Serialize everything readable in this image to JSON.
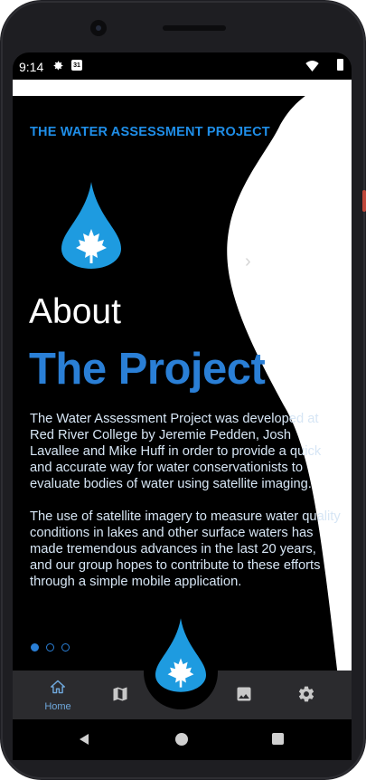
{
  "status_bar": {
    "time": "9:14",
    "calendar_day": "31",
    "icons": [
      "gear-icon",
      "calendar-icon",
      "wifi-icon",
      "battery-icon"
    ]
  },
  "content": {
    "brand_title": "THE WATER ASSESSMENT PROJECT",
    "heading_light": "About",
    "heading_bold": "The Project",
    "paragraph_1": "The Water Assessment Project was developed at Red River College by Jeremie Pedden, Josh Lavallee and Mike Huff in order to provide a quick and accurate way for water conservationists to evaluate bodies of water using satellite imaging.",
    "paragraph_2": "The use of satellite imagery to measure water quality conditions in lakes and other surface waters has made tremendous advances in the last 20 years, and our group hopes to contribute to these efforts through a simple mobile application.",
    "next_icon": "chevron-right-icon",
    "page_count": 3,
    "active_page": 1
  },
  "bottom_nav": {
    "home_label": "Home",
    "items": [
      "home-icon",
      "map-icon",
      "water-drop-logo",
      "image-icon",
      "settings-icon"
    ]
  },
  "colors": {
    "accent_blue": "#2a7fd6",
    "title_blue": "#1f8ee8",
    "drop_blue": "#1e9be0",
    "screen_bg": "#000000",
    "wave_panel": "#ffffff",
    "nav_bg": "#2b2b2e"
  }
}
